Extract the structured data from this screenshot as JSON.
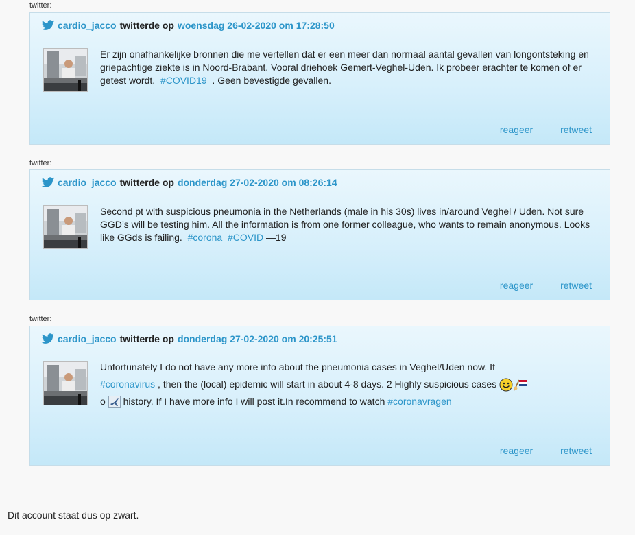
{
  "label": "twitter:",
  "tweets": [
    {
      "handle": "cardio_jacco",
      "verb": "twitterde op",
      "date": "woensdag 26-02-2020 om 17:28:50",
      "text1": "Er zijn onafhankelijke bronnen die me vertellen dat er een meer dan normaal aantal gevallen van longontsteking en griepachtige ziekte is in Noord-Brabant. Vooral driehoek Gemert-Veghel-Uden. Ik probeer erachter te komen of er getest wordt.",
      "tag1": "#COVID19",
      "text2": ". Geen bevestigde gevallen.",
      "reply": "reageer",
      "retweet": "retweet"
    },
    {
      "handle": "cardio_jacco",
      "verb": "twitterde op",
      "date": "donderdag 27-02-2020 om 08:26:14",
      "text1": "Second pt with suspicious pneumonia in the Netherlands (male in his 30s) lives in/around Veghel / Uden. Not sure GGD’s will be testing him. All the information is from one former colleague, who wants to remain anonymous. Looks like GGds is failing.",
      "tag1": "#corona",
      "tag2": "#COVID",
      "text2": "—19",
      "reply": "reageer",
      "retweet": "retweet"
    },
    {
      "handle": "cardio_jacco",
      "verb": "twitterde op",
      "date": "donderdag 27-02-2020 om 20:25:51",
      "text1": "Unfortunately I do not have any more info about the pneumonia cases in Veghel/Uden now. If",
      "tag1": "#coronavirus",
      "text2": ", then the (local) epidemic will start in about 4-8 days. 2 Highly suspicious cases",
      "text3": "o",
      "text4": "history. If I have more info I will post it.In recommend to watch",
      "tag2": "#coronavragen",
      "reply": "reageer",
      "retweet": "retweet"
    }
  ],
  "footer": "Dit account staat dus op zwart.",
  "colors": {
    "link": "#2c95c9",
    "tweet_bg_top": "#eaf7fd",
    "tweet_bg_bottom": "#c4e8f8"
  }
}
